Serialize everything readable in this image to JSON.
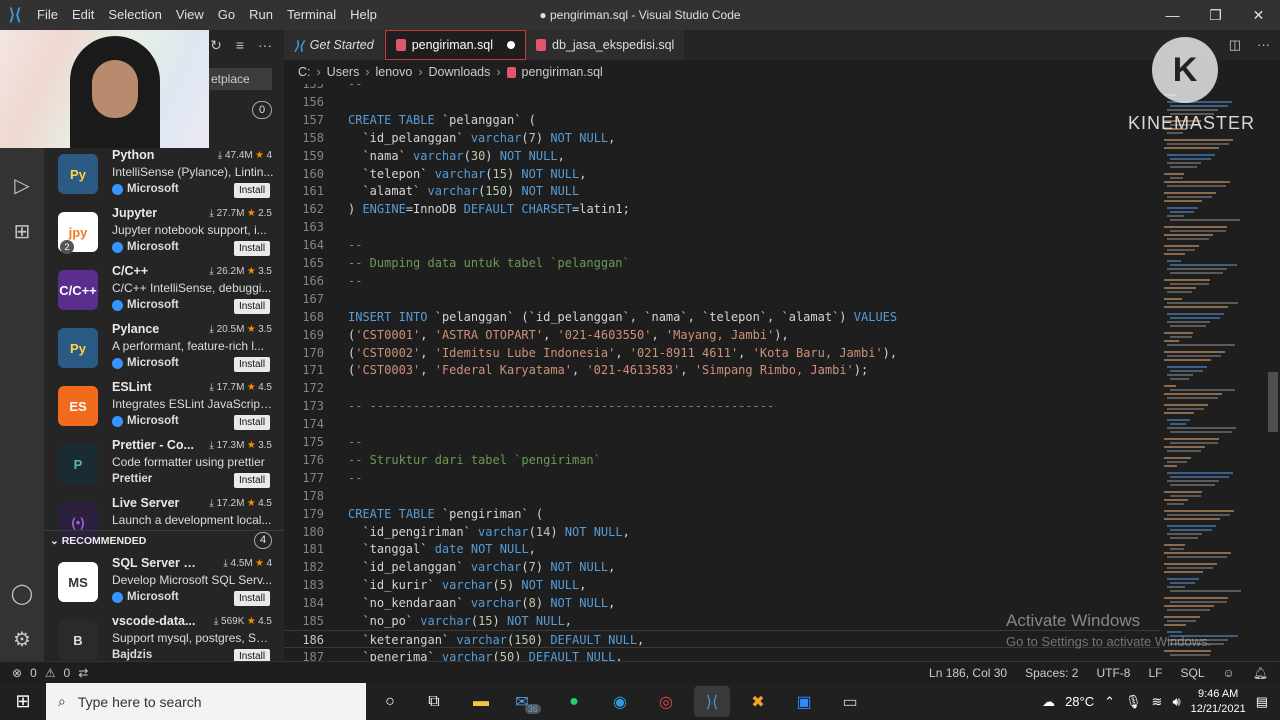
{
  "window": {
    "title": "● pengiriman.sql - Visual Studio Code",
    "menu": [
      "File",
      "Edit",
      "Selection",
      "View",
      "Go",
      "Run",
      "Terminal",
      "Help"
    ]
  },
  "sidebar": {
    "search_placeholder": "etplace",
    "installed_count": "0",
    "extensions": [
      {
        "name": "Python",
        "downloads": "47.4M",
        "rating": "4",
        "desc": "IntelliSense (Pylance), Lintin...",
        "publisher": "Microsoft",
        "verified": true,
        "icon": "python-icon",
        "install": "Install"
      },
      {
        "name": "Jupyter",
        "downloads": "27.7M",
        "rating": "2.5",
        "desc": "Jupyter notebook support, i...",
        "publisher": "Microsoft",
        "verified": true,
        "icon": "jupyter-icon",
        "badge": "2",
        "install": "Install"
      },
      {
        "name": "C/C++",
        "downloads": "26.2M",
        "rating": "3.5",
        "desc": "C/C++ IntelliSense, debuggi...",
        "publisher": "Microsoft",
        "verified": true,
        "icon": "cpp-icon",
        "install": "Install"
      },
      {
        "name": "Pylance",
        "downloads": "20.5M",
        "rating": "3.5",
        "desc": "A performant, feature-rich l...",
        "publisher": "Microsoft",
        "verified": true,
        "icon": "python-icon",
        "install": "Install"
      },
      {
        "name": "ESLint",
        "downloads": "17.7M",
        "rating": "4.5",
        "desc": "Integrates ESLint JavaScript ...",
        "publisher": "Microsoft",
        "verified": true,
        "icon": "eslint-icon",
        "install": "Install"
      },
      {
        "name": "Prettier - Co...",
        "downloads": "17.3M",
        "rating": "3.5",
        "desc": "Code formatter using prettier",
        "publisher": "Prettier",
        "verified": false,
        "icon": "prettier-icon",
        "install": "Install"
      },
      {
        "name": "Live Server",
        "downloads": "17.2M",
        "rating": "4.5",
        "desc": "Launch a development local...",
        "publisher": "",
        "verified": false,
        "icon": "live-server-icon",
        "install": ""
      }
    ],
    "recommended_label": "RECOMMENDED",
    "recommended_count": "4",
    "recommended": [
      {
        "name": "SQL Server (m...",
        "downloads": "4.5M",
        "rating": "4",
        "desc": "Develop Microsoft SQL Serv...",
        "publisher": "Microsoft",
        "verified": true,
        "icon": "microsoft-icon",
        "install": "Install"
      },
      {
        "name": "vscode-data...",
        "downloads": "569K",
        "rating": "4.5",
        "desc": "Support mysql, postgres, SS...",
        "publisher": "Bajdzis",
        "verified": false,
        "icon": "database-icon",
        "install": "Install"
      }
    ]
  },
  "tabs": [
    {
      "label": "Get Started",
      "active": false
    },
    {
      "label": "pengiriman.sql",
      "active": true,
      "modified": true
    },
    {
      "label": "db_jasa_ekspedisi.sql",
      "active": false
    }
  ],
  "breadcrumb": [
    "C:",
    "Users",
    "lenovo",
    "Downloads",
    "pengiriman.sql"
  ],
  "code_lines": [
    {
      "n": "155",
      "t": "--"
    },
    {
      "n": "156",
      "t": ""
    },
    {
      "n": "157",
      "t": "CREATE TABLE `pelanggan` ("
    },
    {
      "n": "158",
      "t": "  `id_pelanggan` varchar(7) NOT NULL,"
    },
    {
      "n": "159",
      "t": "  `nama` varchar(30) NOT NULL,"
    },
    {
      "n": "160",
      "t": "  `telepon` varchar(15) NOT NULL,"
    },
    {
      "n": "161",
      "t": "  `alamat` varchar(150) NOT NULL"
    },
    {
      "n": "162",
      "t": ") ENGINE=InnoDB DEFAULT CHARSET=latin1;"
    },
    {
      "n": "163",
      "t": ""
    },
    {
      "n": "164",
      "t": "--"
    },
    {
      "n": "165",
      "t": "-- Dumping data untuk tabel `pelanggan`"
    },
    {
      "n": "166",
      "t": "--"
    },
    {
      "n": "167",
      "t": ""
    },
    {
      "n": "168",
      "t": "INSERT INTO `pelanggan` (`id_pelanggan`, `nama`, `telepon`, `alamat`) VALUES"
    },
    {
      "n": "169",
      "t": "('CST0001', 'ASTRA OTOPART', '021-4603550', 'Mayang, Jambi'),"
    },
    {
      "n": "170",
      "t": "('CST0002', 'Idemitsu Lube Indonesia', '021-8911 4611', 'Kota Baru, Jambi'),"
    },
    {
      "n": "171",
      "t": "('CST0003', 'Federal Karyatama', '021-4613583', 'Simpang Rimbo, Jambi');"
    },
    {
      "n": "172",
      "t": ""
    },
    {
      "n": "173",
      "t": "-- --------------------------------------------------------"
    },
    {
      "n": "174",
      "t": ""
    },
    {
      "n": "175",
      "t": "--"
    },
    {
      "n": "176",
      "t": "-- Struktur dari tabel `pengiriman`"
    },
    {
      "n": "177",
      "t": "--"
    },
    {
      "n": "178",
      "t": ""
    },
    {
      "n": "179",
      "t": "CREATE TABLE `pengiriman` ("
    },
    {
      "n": "180",
      "t": "  `id_pengiriman` varchar(14) NOT NULL,"
    },
    {
      "n": "181",
      "t": "  `tanggal` date NOT NULL,"
    },
    {
      "n": "182",
      "t": "  `id_pelanggan` varchar(7) NOT NULL,"
    },
    {
      "n": "183",
      "t": "  `id_kurir` varchar(5) NOT NULL,"
    },
    {
      "n": "184",
      "t": "  `no_kendaraan` varchar(8) NOT NULL,"
    },
    {
      "n": "185",
      "t": "  `no_po` varchar(15) NOT NULL,"
    },
    {
      "n": "186",
      "t": "  `keterangan` varchar(150) DEFAULT NULL,"
    },
    {
      "n": "187",
      "t": "  `penerima` varchar(50) DEFAULT NULL,"
    }
  ],
  "current_line": "186",
  "overlay": {
    "kinemaster": "KINEMASTER",
    "kinemaster_letter": "K",
    "activate_title": "Activate Windows",
    "activate_sub": "Go to Settings to activate Windows."
  },
  "statusbar": {
    "errors": "0",
    "warnings": "0",
    "position": "Ln 186, Col 30",
    "spaces": "Spaces: 2",
    "encoding": "UTF-8",
    "eol": "LF",
    "language": "SQL"
  },
  "taskbar": {
    "search_placeholder": "Type here to search",
    "mail_badge": "36",
    "temperature": "28°C",
    "time": "9:46 AM",
    "date": "12/21/2021"
  }
}
